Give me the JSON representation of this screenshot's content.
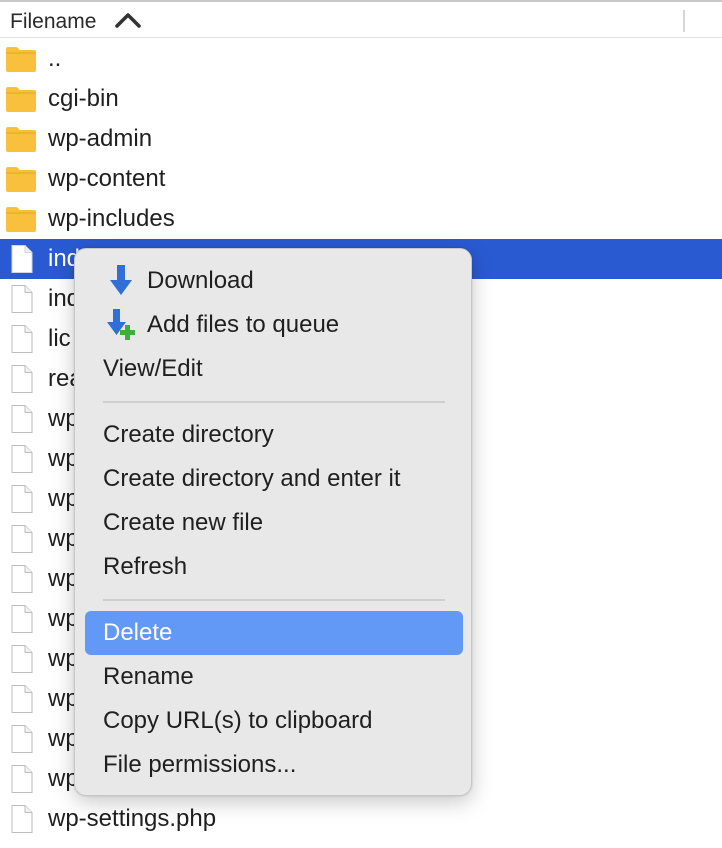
{
  "header": {
    "column_title": "Filename",
    "sort_icon": "chevron-up-icon"
  },
  "files": [
    {
      "name": "..",
      "type": "folder"
    },
    {
      "name": "cgi-bin",
      "type": "folder"
    },
    {
      "name": "wp-admin",
      "type": "folder"
    },
    {
      "name": "wp-content",
      "type": "folder"
    },
    {
      "name": "wp-includes",
      "type": "folder"
    },
    {
      "name": "ind",
      "type": "file",
      "selected": true
    },
    {
      "name": "ind",
      "type": "file"
    },
    {
      "name": "lic",
      "type": "file"
    },
    {
      "name": "rea",
      "type": "file"
    },
    {
      "name": "wp",
      "type": "file"
    },
    {
      "name": "wp",
      "type": "file"
    },
    {
      "name": "wp",
      "type": "file"
    },
    {
      "name": "wp",
      "type": "file"
    },
    {
      "name": "wp",
      "type": "file"
    },
    {
      "name": "wp",
      "type": "file"
    },
    {
      "name": "wp",
      "type": "file"
    },
    {
      "name": "wp",
      "type": "file"
    },
    {
      "name": "wp",
      "type": "file"
    },
    {
      "name": "wp",
      "type": "file"
    },
    {
      "name": "wp-settings.php",
      "type": "file"
    }
  ],
  "context_menu": {
    "download": "Download",
    "add_to_queue": "Add files to queue",
    "view_edit": "View/Edit",
    "create_directory": "Create directory",
    "create_directory_enter": "Create directory and enter it",
    "create_new_file": "Create new file",
    "refresh": "Refresh",
    "delete": "Delete",
    "rename": "Rename",
    "copy_url": "Copy URL(s) to clipboard",
    "file_permissions": "File permissions...",
    "highlighted_item": "Delete"
  },
  "colors": {
    "selection": "#2a5ad2",
    "menu_highlight": "#6298f6",
    "folder": "#f8c03c",
    "download_arrow": "#2f6fd6",
    "queue_plus": "#3cae3c"
  }
}
